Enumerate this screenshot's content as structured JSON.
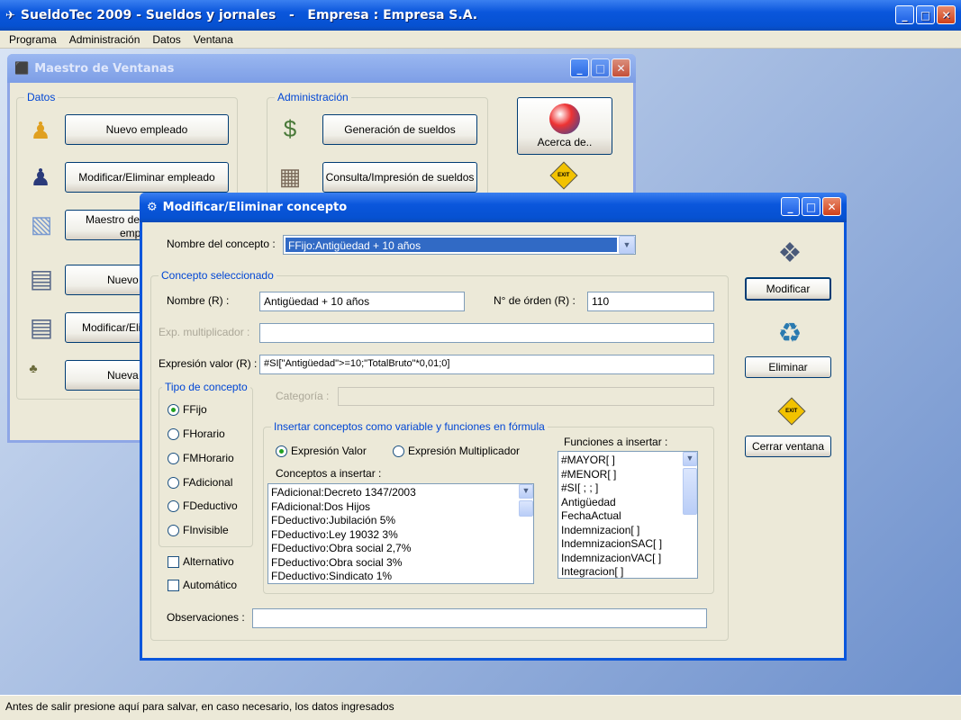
{
  "app": {
    "title": "SueldoTec 2009 - Sueldos y jornales   -   Empresa : Empresa S.A.",
    "min": "_",
    "max": "□",
    "close": "✕"
  },
  "menu": [
    "Programa",
    "Administración",
    "Datos",
    "Ventana"
  ],
  "status": "Antes de salir presione aquí para salvar, en caso necesario, los datos ingresados",
  "maestro": {
    "title": "Maestro de Ventanas",
    "datos_label": "Datos",
    "admin_label": "Administración",
    "datos_buttons": [
      "Nuevo empleado",
      "Modificar/Eliminar empleado",
      "Maestro de",
      "Nuevo",
      "Modificar/Eli",
      "Nueva"
    ],
    "maestro_btn_line2": "emp",
    "admin_buttons": [
      "Generación de sueldos",
      "Consulta/Impresión de sueldos"
    ],
    "acerca": "Acerca de..",
    "exit_sign": "EXIT"
  },
  "dialog": {
    "title": "Modificar/Eliminar concepto",
    "nombre_concepto_label": "Nombre del concepto :",
    "nombre_concepto_value": "FFijo:Antigüedad + 10 años",
    "seleccionado_label": "Concepto seleccionado",
    "nombre_label": "Nombre (R) :",
    "nombre_value": "Antigüedad + 10 años",
    "orden_label": "N° de órden (R) :",
    "orden_value": "110",
    "mult_label": "Exp. multiplicador :",
    "mult_value": "",
    "valor_label": "Expresión valor (R) :",
    "valor_value": "#SI[\"Antigüedad\">=10;\"TotalBruto\"*0,01;0]",
    "tipo_label": "Tipo de concepto",
    "tipos": [
      "FFijo",
      "FHorario",
      "FMHorario",
      "FAdicional",
      "FDeductivo",
      "FInvisible"
    ],
    "categoria_label": "Categoría :",
    "categoria_value": "",
    "insertar_label": "Insertar conceptos como variable y funciones en fórmula",
    "radio_valor": "Expresión Valor",
    "radio_mult": "Expresión Multiplicador",
    "conceptos_label": "Conceptos a insertar :",
    "conceptos": [
      "FAdicional:Decreto 1347/2003",
      "FAdicional:Dos Hijos",
      "FDeductivo:Jubilación 5%",
      "FDeductivo:Ley 19032 3%",
      "FDeductivo:Obra social 2,7%",
      "FDeductivo:Obra social 3%",
      "FDeductivo:Sindicato 1%"
    ],
    "funciones_label": "Funciones a insertar :",
    "funciones": [
      "#MAYOR[  ]",
      "#MENOR[  ]",
      "#SI[  ;  ;  ]",
      "Antigüedad",
      "FechaActual",
      "Indemnizacion[  ]",
      "IndemnizacionSAC[  ]",
      "IndemnizacionVAC[  ]",
      "Integracion[  ]"
    ],
    "alternativo": "Alternativo",
    "automatico": "Automático",
    "observaciones_label": "Observaciones :",
    "observaciones_value": "",
    "btn_modificar": "Modificar",
    "btn_eliminar": "Eliminar",
    "btn_cerrar": "Cerrar ventana",
    "exit_sign": "EXIT"
  }
}
